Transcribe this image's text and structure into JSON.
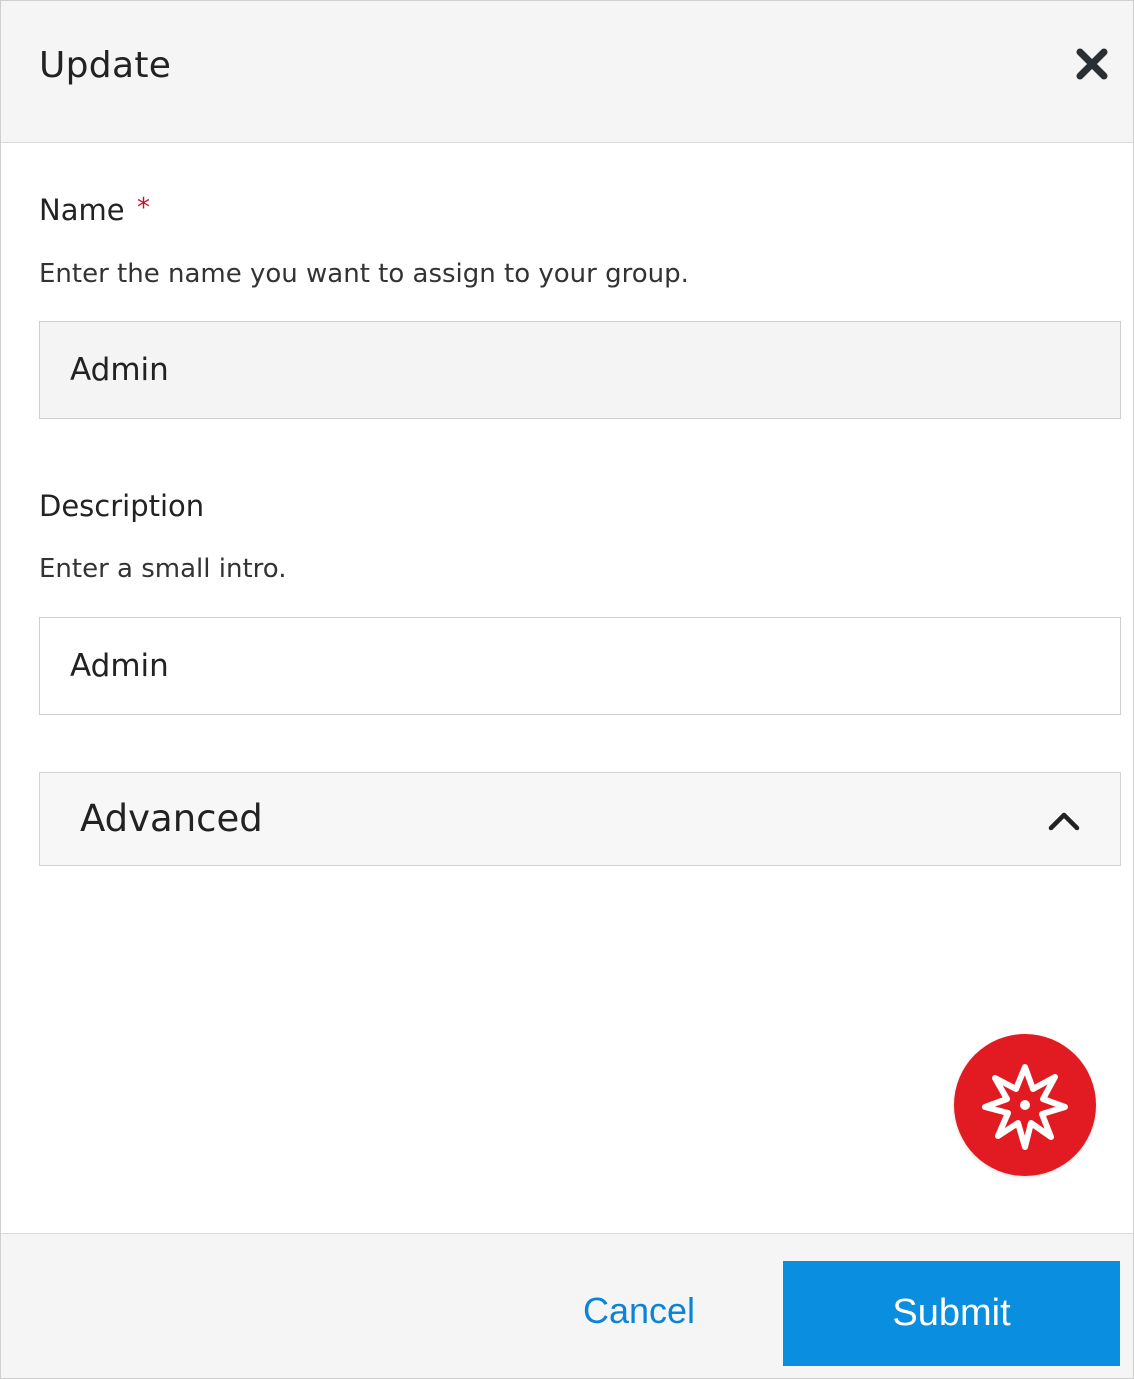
{
  "dialog": {
    "title": "Update"
  },
  "form": {
    "name": {
      "label": "Name",
      "required_marker": "*",
      "help": "Enter the name you want to assign to your group.",
      "value": "Admin"
    },
    "description": {
      "label": "Description",
      "help": "Enter a small intro.",
      "value": "Admin"
    },
    "advanced": {
      "label": "Advanced",
      "icon": "chevron-up-icon"
    }
  },
  "footer": {
    "cancel_label": "Cancel",
    "submit_label": "Submit"
  },
  "icons": {
    "close": "close-icon",
    "fab": "starburst-icon"
  },
  "colors": {
    "accent": "#0a8ee0",
    "link": "#0a84d6",
    "required": "#c8102e",
    "fab": "#e21b23"
  }
}
